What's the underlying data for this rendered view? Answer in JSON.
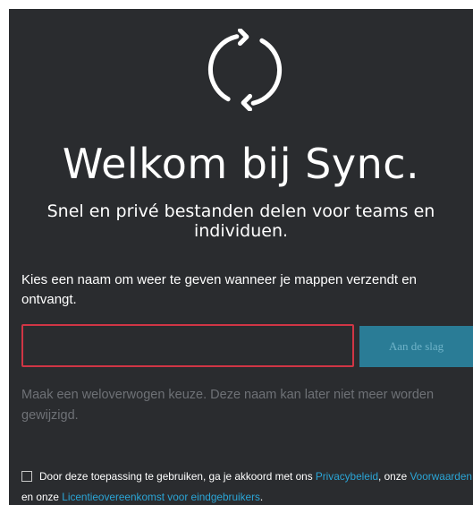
{
  "branding": {
    "logo_icon": "sync-arrows-icon"
  },
  "welcome": {
    "title": "Welkom bij Sync.",
    "subtitle": "Snel en privé bestanden delen voor teams en individuen."
  },
  "form": {
    "prompt": "Kies een naam om weer te geven wanneer je mappen verzendt en ontvangt.",
    "name_value": "",
    "join_button": "Aan de slag",
    "hint": "Maak een weloverwogen keuze. Deze naam kan later niet meer worden gewijzigd."
  },
  "terms": {
    "checked": false,
    "text_1": "Door deze toepassing te gebruiken, ga je akkoord met ons ",
    "privacy_link": "Privacybeleid",
    "text_2": ", onze ",
    "terms_link": "Voorwaarden",
    "text_3": " en onze ",
    "eula_link": "Licentieovereenkomst voor eindgebruikers",
    "text_4": "."
  },
  "colors": {
    "background": "#2a2c2f",
    "accent": "#2a7c96",
    "error_border": "#d03545",
    "link": "#2aa5d6"
  }
}
